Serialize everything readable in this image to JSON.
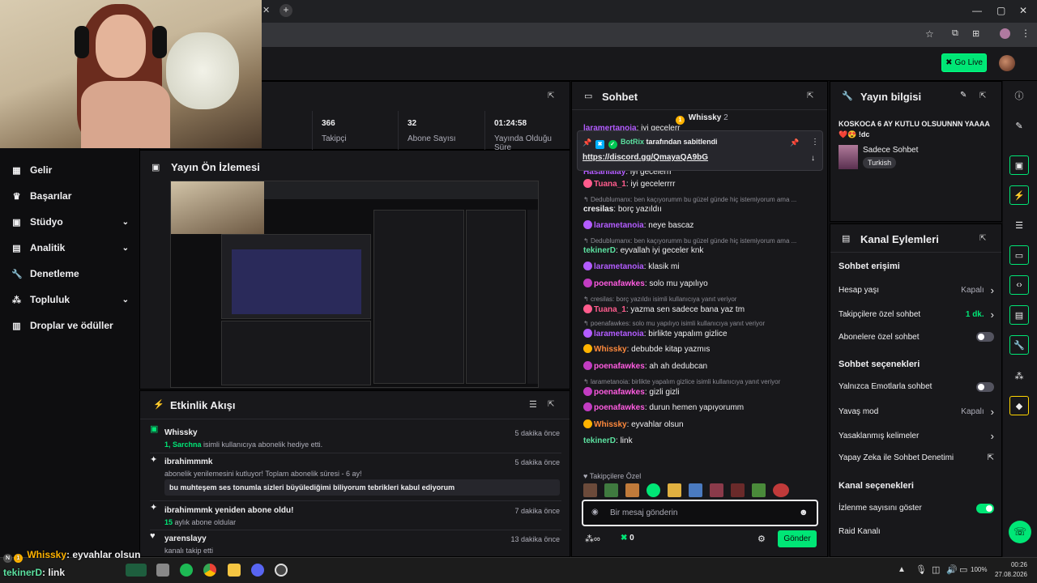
{
  "app": {
    "go_live": "Go Live"
  },
  "sidebar": {
    "items": [
      {
        "label": "Gelir",
        "chevron": false
      },
      {
        "label": "Başarılar",
        "chevron": false
      },
      {
        "label": "Stüdyo",
        "chevron": true
      },
      {
        "label": "Analitik",
        "chevron": true
      },
      {
        "label": "Denetleme",
        "chevron": false
      },
      {
        "label": "Topluluk",
        "chevron": true
      },
      {
        "label": "Droplar ve ödüller",
        "chevron": false
      }
    ]
  },
  "stats": [
    {
      "value": "366",
      "label": "Takipçi"
    },
    {
      "value": "32",
      "label": "Abone Sayısı"
    },
    {
      "value": "01:24:58",
      "label": "Yayında Olduğu Süre"
    }
  ],
  "preview": {
    "title": "Yayın Ön İzlemesi"
  },
  "activity": {
    "title": "Etkinlik Akışı",
    "items": [
      {
        "name": "Whissky",
        "sub_user": "1, Sarchna",
        "sub_text": " isimli kullanıcıya abonelik hediye etti.",
        "time": "5 dakika önce"
      },
      {
        "name": "ibrahimmmk",
        "sub_user": "",
        "sub_text": "abonelik yenilemesini kutluyor! Toplam abonelik süresi - 6 ay!",
        "time": "5 dakika önce",
        "message": "bu muhteşem ses tonumla sizleri büyülediğimi biliyorum tebrikleri kabul ediyorum"
      },
      {
        "name": "ibrahimmmk yeniden abone oldu!",
        "sub_user": "15",
        "sub_text": " aylık abone oldular",
        "time": "7 dakika önce"
      },
      {
        "name": "yarenslayy",
        "sub_user": "",
        "sub_text": "kanalı takip etti",
        "time": "13 dakika önce"
      }
    ]
  },
  "chat": {
    "title": "Sohbet",
    "top_gifter": {
      "name": "Whissky",
      "count": "2"
    },
    "pinned": {
      "by": "BotRix",
      "by_suffix": "tarafından sabitlendi",
      "link": "https://discord.gg/QmayaQA9bG"
    },
    "messages": [
      {
        "reply": "",
        "user": "laramertanoia",
        "color": "#b35cff",
        "text": "iyi gecelerr"
      },
      {
        "reply": "",
        "user": "Hasanlalay",
        "color": "#b35cff",
        "text": "iyi gecelerrr"
      },
      {
        "reply": "",
        "user": "Tuana_1",
        "color": "#ff5c8d",
        "text": "iyi gecelerrrr"
      },
      {
        "reply": "Dedublumanx: ben kaçıyorumm bu güzel günde hiç istemiyorum ama ...",
        "user": "cresilas",
        "color": "#efeff1",
        "text": "borç yazıldıı"
      },
      {
        "reply": "",
        "user": "larametanoia",
        "color": "#b35cff",
        "text": "neye bascaz"
      },
      {
        "reply": "Dedublumanx: ben kaçıyorumm bu güzel günde hiç istemiyorum ama ...",
        "user": "tekinerD",
        "color": "#5ce1a0",
        "text": "eyvallah iyi geceler knk"
      },
      {
        "reply": "",
        "user": "larametanoia",
        "color": "#b35cff",
        "text": "klasik mi"
      },
      {
        "reply": "",
        "user": "poenafawkes",
        "color": "#ff5ce1",
        "text": "solo mu yapılıyo"
      },
      {
        "reply": "cresilas: borç yazıldıı isimli kullanıcıya yanıt veriyor",
        "user": "Tuana_1",
        "color": "#ff5c8d",
        "text": "yazma sen sadece bana yaz tm"
      },
      {
        "reply": "poenafawkes: solo mu yapılıyo isimli kullanıcıya yanıt veriyor",
        "user": "larametanoia",
        "color": "#b35cff",
        "text": "birlikte yapalım gizlice"
      },
      {
        "reply": "",
        "user": "Whissky",
        "color": "#ff8a3d",
        "text": "debubde kitap yazmıs"
      },
      {
        "reply": "",
        "user": "poenafawkes",
        "color": "#ff5ce1",
        "text": "ah ah dedubcan"
      },
      {
        "reply": "larametanoia: birlikte yapalım gizlice isimli kullanıcıya yanıt veriyor",
        "user": "poenafawkes",
        "color": "#ff5ce1",
        "text": "gizli gizli"
      },
      {
        "reply": "",
        "user": "poenafawkes",
        "color": "#ff5ce1",
        "text": "durun hemen yapıyorumm"
      },
      {
        "reply": "",
        "user": "Whissky",
        "color": "#ff8a3d",
        "text": "eyvahlar olsun"
      },
      {
        "reply": "",
        "user": "tekinerD",
        "color": "#5ce1a0",
        "text": "link"
      }
    ],
    "followers_only": "Takipçilere Özel",
    "input_placeholder": "Bir mesaj gönderin",
    "points": "0",
    "send": "Gönder"
  },
  "stream_info": {
    "title": "Yayın bilgisi",
    "stream_title": "KOSKOCA 6 AY KUTLU OLSUUNNN YAAAA❤️😍 !dc",
    "category": "Sadece Sohbet",
    "tag": "Turkish"
  },
  "channel_actions": {
    "title": "Kanal Eylemleri",
    "sections": [
      {
        "heading": "Sohbet erişimi",
        "rows": [
          {
            "label": "Hesap yaşı",
            "value": "Kapalı",
            "type": "chevron"
          },
          {
            "label": "Takipçilere özel sohbet",
            "value": "1 dk.",
            "type": "chevron"
          },
          {
            "label": "Abonelere özel sohbet",
            "value": "",
            "type": "toggle-off"
          }
        ]
      },
      {
        "heading": "Sohbet seçenekleri",
        "rows": [
          {
            "label": "Yalnızca Emotlarla sohbet",
            "value": "",
            "type": "toggle-off"
          },
          {
            "label": "Yavaş mod",
            "value": "Kapalı",
            "type": "chevron"
          },
          {
            "label": "Yasaklanmış kelimeler",
            "value": "",
            "type": "chevron"
          },
          {
            "label": "Yapay Zeka ile Sohbet Denetimi",
            "value": "",
            "type": "external"
          }
        ]
      },
      {
        "heading": "Kanal seçenekleri",
        "rows": [
          {
            "label": "İzlenme sayısını göster",
            "value": "",
            "type": "toggle-on"
          },
          {
            "label": "Raid Kanalı",
            "value": "",
            "type": "none"
          }
        ]
      }
    ]
  },
  "overlay_chat": [
    {
      "user": "Whissky",
      "text": ": eyvahlar olsun"
    },
    {
      "user": "tekinerD",
      "text": ": link"
    }
  ],
  "taskbar": {
    "battery": "100%",
    "time": "00:26",
    "date": "27.08.2026"
  },
  "colors": {
    "accent": "#00e676",
    "panel": "#18181b",
    "bg": "#0e0e10"
  }
}
